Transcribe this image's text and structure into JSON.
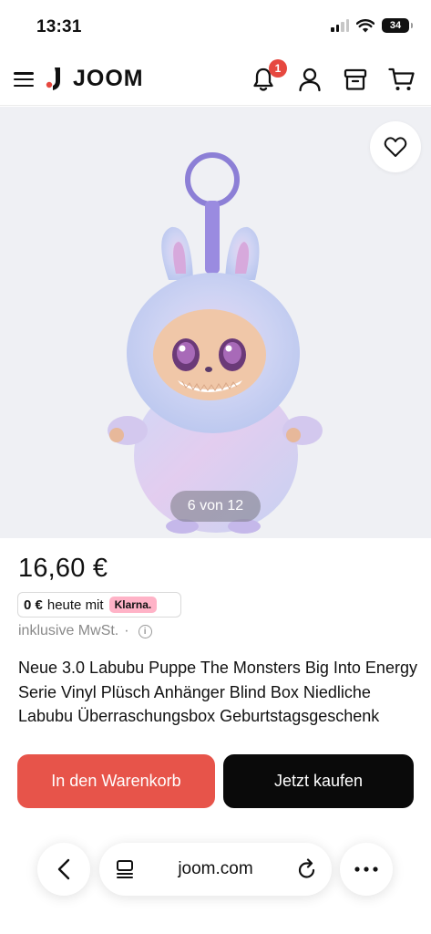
{
  "status_bar": {
    "time": "13:31",
    "battery": "34"
  },
  "header": {
    "logo_text": "JOOM",
    "notification_count": "1",
    "brand_color": "#e6483f"
  },
  "gallery": {
    "counter": "6 von 12"
  },
  "product": {
    "price": "16,60 €",
    "klarna_amount": "0 €",
    "klarna_text": "heute mit",
    "klarna_logo": "Klarna.",
    "tax_note": "inklusive MwSt.",
    "tax_separator": "·",
    "title": "Neue 3.0 Labubu Puppe The Monsters Big Into Energy Serie Vinyl Plüsch Anhänger Blind Box Niedliche Labubu Überraschungsbox Geburtstagsgeschenk"
  },
  "actions": {
    "add_to_cart": "In den Warenkorb",
    "buy_now": "Jetzt kaufen",
    "cart_color": "#e7544a",
    "buy_color": "#0a0a0a"
  },
  "browser": {
    "url": "joom.com"
  },
  "icons": [
    "menu-icon",
    "bell-icon",
    "user-icon",
    "archive-icon",
    "cart-icon",
    "heart-icon",
    "back-icon",
    "tabs-icon",
    "reload-icon",
    "more-icon",
    "info-icon"
  ]
}
